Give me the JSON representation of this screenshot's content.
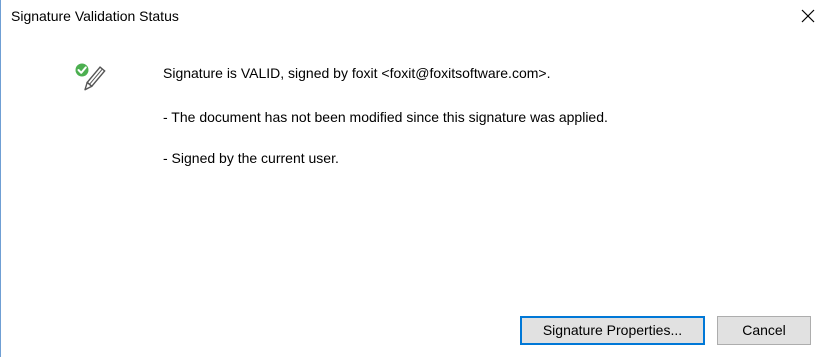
{
  "dialog": {
    "title": "Signature Validation Status",
    "close_icon": "close-icon"
  },
  "status": {
    "icon": "signature-valid-icon",
    "accent_color": "#4caf50",
    "line1": "Signature is VALID, signed by foxit <foxit@foxitsoftware.com>.",
    "line2": "- The document has not been modified since this signature was applied.",
    "line3": "- Signed by the current user."
  },
  "buttons": {
    "properties_label": "Signature Properties...",
    "cancel_label": "Cancel",
    "focus_color": "#0078d7"
  }
}
